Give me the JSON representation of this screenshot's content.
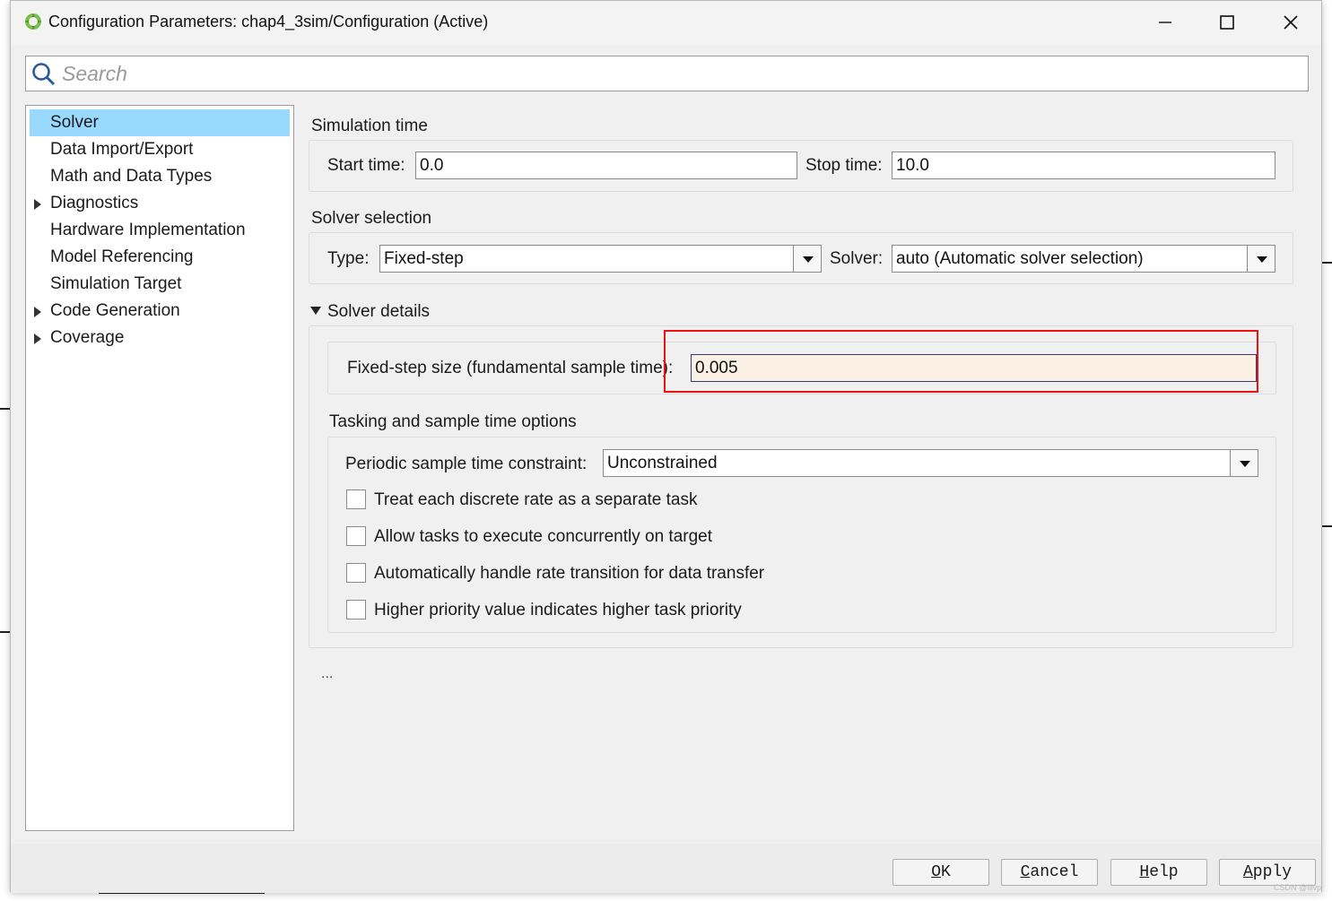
{
  "window": {
    "title": "Configuration Parameters: chap4_3sim/Configuration (Active)",
    "minimize_icon": "minimize-icon",
    "maximize_icon": "maximize-icon",
    "close_icon": "close-icon"
  },
  "search": {
    "placeholder": "Search",
    "value": ""
  },
  "tree": {
    "items": [
      {
        "label": "Solver",
        "selected": true,
        "expandable": false
      },
      {
        "label": "Data Import/Export",
        "selected": false,
        "expandable": false
      },
      {
        "label": "Math and Data Types",
        "selected": false,
        "expandable": false
      },
      {
        "label": "Diagnostics",
        "selected": false,
        "expandable": true
      },
      {
        "label": "Hardware Implementation",
        "selected": false,
        "expandable": false
      },
      {
        "label": "Model Referencing",
        "selected": false,
        "expandable": false
      },
      {
        "label": "Simulation Target",
        "selected": false,
        "expandable": false
      },
      {
        "label": "Code Generation",
        "selected": false,
        "expandable": true
      },
      {
        "label": "Coverage",
        "selected": false,
        "expandable": true
      }
    ]
  },
  "simulation_time": {
    "title": "Simulation time",
    "start_label": "Start time:",
    "start_value": "0.0",
    "stop_label": "Stop time:",
    "stop_value": "10.0"
  },
  "solver_selection": {
    "title": "Solver selection",
    "type_label": "Type:",
    "type_value": "Fixed-step",
    "solver_label": "Solver:",
    "solver_value": "auto (Automatic solver selection)"
  },
  "solver_details": {
    "title": "Solver details",
    "step_label": "Fixed-step size (fundamental sample time):",
    "step_value": "0.005"
  },
  "tasking": {
    "title": "Tasking and sample time options",
    "constraint_label": "Periodic sample time constraint:",
    "constraint_value": "Unconstrained",
    "checkboxes": [
      {
        "label": "Treat each discrete rate as a separate task",
        "checked": false
      },
      {
        "label": "Allow tasks to execute concurrently on target",
        "checked": false
      },
      {
        "label": "Automatically handle rate transition for data transfer",
        "checked": false
      },
      {
        "label": "Higher priority value indicates higher task priority",
        "checked": false
      }
    ]
  },
  "more": "...",
  "buttons": {
    "ok_mnemonic": "O",
    "ok_rest": "K",
    "cancel_mnemonic": "C",
    "cancel_rest": "ancel",
    "help_mnemonic": "H",
    "help_rest": "elp",
    "apply_mnemonic": "A",
    "apply_rest": "pply"
  },
  "watermark": "CSDN @Ilivp",
  "colors": {
    "selection": "#99d9ff",
    "highlight_field": "#fbf0e4",
    "annotation_box": "#ee1111"
  }
}
